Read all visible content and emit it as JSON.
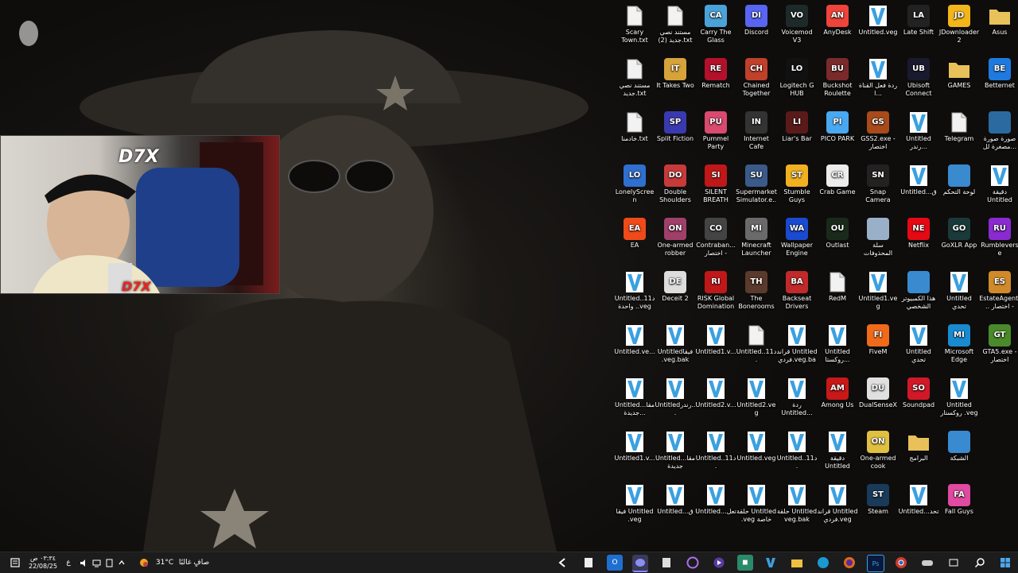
{
  "desktop": {
    "icons": [
      {
        "label": "Scary Town.txt",
        "icon": "text-file-icon",
        "color": "#e8e8e8"
      },
      {
        "label": "مستند نصي جديد (2).txt",
        "icon": "text-file-icon",
        "color": "#e8e8e8"
      },
      {
        "label": "Carry The Glass",
        "icon": "game-icon",
        "color": "#4aa3d8"
      },
      {
        "label": "Discord",
        "icon": "discord-icon",
        "color": "#5865f2"
      },
      {
        "label": "Voicemod V3",
        "icon": "voicemod-icon",
        "color": "#1e2a2a"
      },
      {
        "label": "AnyDesk",
        "icon": "anydesk-icon",
        "color": "#ef443b"
      },
      {
        "label": "Untitled.veg",
        "icon": "vegas-file-icon",
        "color": "#3aa0e0"
      },
      {
        "label": "Late Shift",
        "icon": "game-icon",
        "color": "#222222"
      },
      {
        "label": "JDownloader 2",
        "icon": "jdownloader-icon",
        "color": "#f2b61b"
      },
      {
        "label": "Asus",
        "icon": "folder-icon",
        "color": "#e8c15a"
      },
      {
        "label": "مستند نصي جديد.txt",
        "icon": "text-file-icon",
        "color": "#e8e8e8"
      },
      {
        "label": "It Takes Two",
        "icon": "game-icon",
        "color": "#d6a23a"
      },
      {
        "label": "Rematch",
        "icon": "game-icon",
        "color": "#b3112b"
      },
      {
        "label": "Chained Together",
        "icon": "game-icon",
        "color": "#c0402a"
      },
      {
        "label": "Logitech G HUB",
        "icon": "logitech-icon",
        "color": "#111111"
      },
      {
        "label": "Buckshot Roulette",
        "icon": "game-icon",
        "color": "#7a2a2a"
      },
      {
        "label": "ردة فعل القناة ا...",
        "icon": "vegas-file-icon",
        "color": "#3aa0e0"
      },
      {
        "label": "Ubisoft Connect",
        "icon": "ubisoft-icon",
        "color": "#1a1a2e"
      },
      {
        "label": "GAMES",
        "icon": "folder-icon",
        "color": "#e8c15a"
      },
      {
        "label": "Betternet",
        "icon": "betternet-icon",
        "color": "#1f7ae0"
      },
      {
        "label": "خادمنا.txt",
        "icon": "text-file-icon",
        "color": "#e8e8e8"
      },
      {
        "label": "Split Fiction",
        "icon": "game-icon",
        "color": "#3a3ab0"
      },
      {
        "label": "Pummel Party",
        "icon": "game-icon",
        "color": "#d94a6e"
      },
      {
        "label": "Internet Cafe Simulator 2...",
        "icon": "game-icon",
        "color": "#333333"
      },
      {
        "label": "Liar's Bar",
        "icon": "game-icon",
        "color": "#5a1a1a"
      },
      {
        "label": "PICO PARK",
        "icon": "game-icon",
        "color": "#4aa8f0"
      },
      {
        "label": "GSS2.exe - اختصار",
        "icon": "game-icon",
        "color": "#a84a1a"
      },
      {
        "label": "Untitled رندر...",
        "icon": "vegas-file-icon",
        "color": "#3aa0e0"
      },
      {
        "label": "Telegram",
        "icon": "text-file-icon",
        "color": "#e8e8e8"
      },
      {
        "label": "صورة صورة مصغرة لل...",
        "icon": "image-icon",
        "color": "#2a6aa0"
      },
      {
        "label": "LonelyScreen",
        "icon": "monitor-icon",
        "color": "#2f6fd0"
      },
      {
        "label": "Double Shoulders",
        "icon": "game-icon",
        "color": "#c83a3a"
      },
      {
        "label": "SILENT BREATH",
        "icon": "game-icon",
        "color": "#c01818"
      },
      {
        "label": "Supermarket Simulator.e...",
        "icon": "game-icon",
        "color": "#3a5a8a"
      },
      {
        "label": "Stumble Guys",
        "icon": "game-icon",
        "color": "#f0b020"
      },
      {
        "label": "Crab Game",
        "icon": "game-icon",
        "color": "#ececec"
      },
      {
        "label": "Snap Camera",
        "icon": "camera-icon",
        "color": "#222222"
      },
      {
        "label": "Untitled...ق",
        "icon": "vegas-file-icon",
        "color": "#3aa0e0"
      },
      {
        "label": "لوحة التحكم",
        "icon": "control-panel-icon",
        "color": "#3a8ad0"
      },
      {
        "label": "دقيقة Untitled واحدة.veg",
        "icon": "vegas-file-icon",
        "color": "#3aa0e0"
      },
      {
        "label": "EA",
        "icon": "ea-icon",
        "color": "#f04a1a"
      },
      {
        "label": "One-armed robber",
        "icon": "game-icon",
        "color": "#a0406a"
      },
      {
        "label": "Contraban... اختصار -",
        "icon": "game-icon",
        "color": "#444444"
      },
      {
        "label": "Minecraft Launcher",
        "icon": "minecraft-icon",
        "color": "#6a6a6a"
      },
      {
        "label": "Wallpaper Engine",
        "icon": "wallpaper-engine-icon",
        "color": "#1a4ad0"
      },
      {
        "label": "Outlast",
        "icon": "game-icon",
        "color": "#1a2a1a"
      },
      {
        "label": "سلة المحذوفات",
        "icon": "recycle-bin-icon",
        "color": "#9ab0c8"
      },
      {
        "label": "Netflix",
        "icon": "netflix-icon",
        "color": "#e50914"
      },
      {
        "label": "GoXLR App",
        "icon": "goxlr-icon",
        "color": "#1a3a3a"
      },
      {
        "label": "Rumbleverse",
        "icon": "game-icon",
        "color": "#8a2ad0"
      },
      {
        "label": "Untitledد11... واحدة.veg",
        "icon": "vegas-file-icon",
        "color": "#3aa0e0"
      },
      {
        "label": "Deceit 2",
        "icon": "game-icon",
        "color": "#dddddd"
      },
      {
        "label": "RISK Global Domination",
        "icon": "game-icon",
        "color": "#c01818"
      },
      {
        "label": "The Bonerooms",
        "icon": "game-icon",
        "color": "#5a3a2a"
      },
      {
        "label": "Backseat Drivers Demo",
        "icon": "game-icon",
        "color": "#c02a2a"
      },
      {
        "label": "RedM",
        "icon": "text-file-icon",
        "color": "#e8e8e8"
      },
      {
        "label": "Untitled1.veg",
        "icon": "vegas-file-icon",
        "color": "#3aa0e0"
      },
      {
        "label": "هذا الكمبيوتر الشخصي",
        "icon": "computer-icon",
        "color": "#3a8ad0"
      },
      {
        "label": "Untitled تحدي الضحك.veg...",
        "icon": "vegas-file-icon",
        "color": "#3aa0e0"
      },
      {
        "label": "EstateAgent... اختصار -",
        "icon": "game-icon",
        "color": "#d08a2a"
      },
      {
        "label": "Untitled.ve...",
        "icon": "vegas-file-icon",
        "color": "#3aa0e0"
      },
      {
        "label": "Untitledفيقا .veg.bak",
        "icon": "vegas-file-icon",
        "color": "#3aa0e0"
      },
      {
        "label": "Untitled1.v...",
        "icon": "vegas-file-icon",
        "color": "#3aa0e0"
      },
      {
        "label": "Untitledد11... واحدة.veg.b...",
        "icon": "text-file-icon",
        "color": "#e8e8e8"
      },
      {
        "label": "قراند Untitled فردي.veg.bak",
        "icon": "vegas-file-icon",
        "color": "#3aa0e0"
      },
      {
        "label": "Untitled روكستا...",
        "icon": "vegas-file-icon",
        "color": "#3aa0e0"
      },
      {
        "label": "FiveM",
        "icon": "fivem-icon",
        "color": "#f06a1a"
      },
      {
        "label": "Untitled تحدي الضحك.veg",
        "icon": "vegas-file-icon",
        "color": "#3aa0e0"
      },
      {
        "label": "Microsoft Edge",
        "icon": "edge-icon",
        "color": "#1a8ad0"
      },
      {
        "label": "GTA5.exe - اختصار",
        "icon": "gta-icon",
        "color": "#4a8a2a"
      },
      {
        "label": "Untitledمقا... جديدة...",
        "icon": "vegas-file-icon",
        "color": "#3aa0e0"
      },
      {
        "label": "Untitledرندر...",
        "icon": "vegas-file-icon",
        "color": "#3aa0e0"
      },
      {
        "label": "Untitled2.v...",
        "icon": "vegas-file-icon",
        "color": "#3aa0e0"
      },
      {
        "label": "Untitled2.veg",
        "icon": "vegas-file-icon",
        "color": "#3aa0e0"
      },
      {
        "label": "ردة Untitled... فعل القنا",
        "icon": "vegas-file-icon",
        "color": "#3aa0e0"
      },
      {
        "label": "Among Us",
        "icon": "among-us-icon",
        "color": "#c81818"
      },
      {
        "label": "DualSenseX",
        "icon": "dualsense-icon",
        "color": "#e0e0e0"
      },
      {
        "label": "Soundpad",
        "icon": "soundpad-icon",
        "color": "#d01828"
      },
      {
        "label": "Untitled روكستار .veg",
        "icon": "vegas-file-icon",
        "color": "#3aa0e0"
      },
      {
        "label": "",
        "icon": "",
        "color": ""
      },
      {
        "label": "Untitled1.v...",
        "icon": "vegas-file-icon",
        "color": "#3aa0e0"
      },
      {
        "label": "Untitledمقا... جديدة",
        "icon": "vegas-file-icon",
        "color": "#3aa0e0"
      },
      {
        "label": "Untitledد11... واحدة.veg.b...",
        "icon": "vegas-file-icon",
        "color": "#3aa0e0"
      },
      {
        "label": "Untitled.veg",
        "icon": "vegas-file-icon",
        "color": "#3aa0e0"
      },
      {
        "label": "Untitledد11... واحدة.veg.bak",
        "icon": "vegas-file-icon",
        "color": "#3aa0e0"
      },
      {
        "label": "دقيقة Untitled واحدة.veg.bak",
        "icon": "vegas-file-icon",
        "color": "#3aa0e0"
      },
      {
        "label": "One-armed cook",
        "icon": "game-icon",
        "color": "#e0c040"
      },
      {
        "label": "البرامج",
        "icon": "folder-icon",
        "color": "#e8c15a"
      },
      {
        "label": "الشبكة",
        "icon": "network-icon",
        "color": "#3a8ad0"
      },
      {
        "label": "",
        "icon": "",
        "color": ""
      },
      {
        "label": "فيقا Untitled .veg",
        "icon": "vegas-file-icon",
        "color": "#3aa0e0"
      },
      {
        "label": "Untitled...ق",
        "icon": "vegas-file-icon",
        "color": "#3aa0e0"
      },
      {
        "label": "Untitled...تعل",
        "icon": "vegas-file-icon",
        "color": "#3aa0e0"
      },
      {
        "label": "حلقة Untitled .veg خاصة",
        "icon": "vegas-file-icon",
        "color": "#3aa0e0"
      },
      {
        "label": "حلقة Untitled veg.bak خاصة",
        "icon": "vegas-file-icon",
        "color": "#3aa0e0"
      },
      {
        "label": "قراند Untitled فردي.veg",
        "icon": "vegas-file-icon",
        "color": "#3aa0e0"
      },
      {
        "label": "Steam",
        "icon": "steam-icon",
        "color": "#1a3a5a"
      },
      {
        "label": "Untitled...تحد",
        "icon": "vegas-file-icon",
        "color": "#3aa0e0"
      },
      {
        "label": "Fall Guys",
        "icon": "fall-guys-icon",
        "color": "#e04aa0"
      },
      {
        "label": "",
        "icon": "",
        "color": ""
      }
    ]
  },
  "webcam": {
    "logo_text": "D7X"
  },
  "taskbar": {
    "time": "٠٣:٣٤ ص",
    "date": "22/08/25",
    "lang": "ع",
    "weather_temp": "31°C",
    "weather_text": "صافٍ غالبًا"
  }
}
